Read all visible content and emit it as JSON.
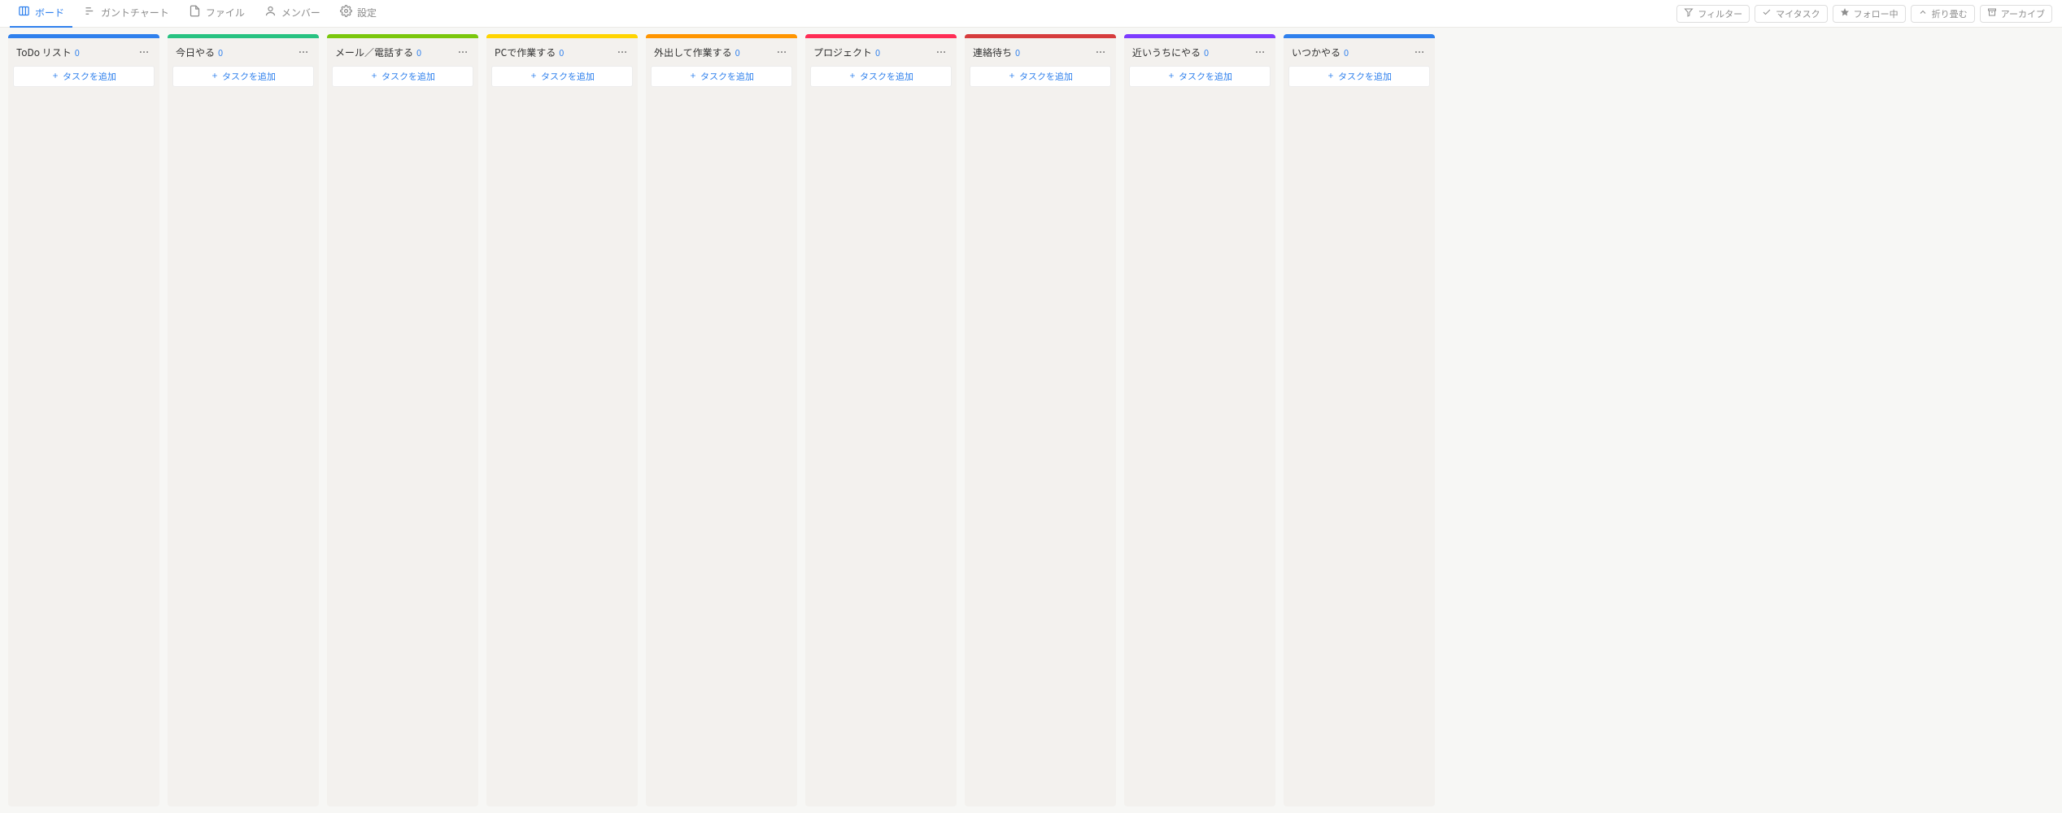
{
  "nav": {
    "tabs": [
      {
        "id": "board",
        "label": "ボード",
        "active": true
      },
      {
        "id": "gantt",
        "label": "ガントチャート",
        "active": false
      },
      {
        "id": "files",
        "label": "ファイル",
        "active": false
      },
      {
        "id": "members",
        "label": "メンバー",
        "active": false
      },
      {
        "id": "settings",
        "label": "設定",
        "active": false
      }
    ],
    "buttons": [
      {
        "id": "filter",
        "label": "フィルター"
      },
      {
        "id": "my-task",
        "label": "マイタスク"
      },
      {
        "id": "following",
        "label": "フォロー中"
      },
      {
        "id": "collapse",
        "label": "折り畳む"
      },
      {
        "id": "archive",
        "label": "アーカイブ"
      }
    ]
  },
  "board": {
    "addTaskLabel": "タスクを追加",
    "columns": [
      {
        "title": "ToDo リスト",
        "count": 0,
        "color": "#2f80ed"
      },
      {
        "title": "今日やる",
        "count": 0,
        "color": "#27c281"
      },
      {
        "title": "メール／電話する",
        "count": 0,
        "color": "#7ac70c"
      },
      {
        "title": "PCで作業する",
        "count": 0,
        "color": "#ffd400"
      },
      {
        "title": "外出して作業する",
        "count": 0,
        "color": "#ff9500"
      },
      {
        "title": "プロジェクト",
        "count": 0,
        "color": "#ff2d55"
      },
      {
        "title": "連絡待ち",
        "count": 0,
        "color": "#d63c3c"
      },
      {
        "title": "近いうちにやる",
        "count": 0,
        "color": "#7d3cff"
      },
      {
        "title": "いつかやる",
        "count": 0,
        "color": "#2f80ed"
      }
    ]
  }
}
